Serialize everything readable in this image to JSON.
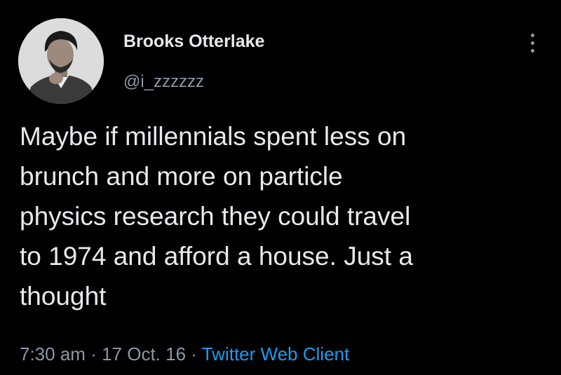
{
  "author": {
    "display_name": "Brooks Otterlake",
    "handle": "@i_zzzzzz",
    "avatar_icon": "profile-photo"
  },
  "menu": {
    "icon": "more-options-icon"
  },
  "tweet": {
    "lines": [
      "Maybe if millennials spent less on",
      "brunch and more on particle",
      "physics research they could travel",
      "to 1974 and afford a house. Just a",
      "thought"
    ]
  },
  "meta": {
    "time": "7:30 am",
    "separator": "·",
    "date": "17 Oct. 16",
    "source": "Twitter Web Client"
  },
  "colors": {
    "background": "#000000",
    "primary_text": "#e7e9ea",
    "secondary_text": "#8b98a5",
    "link": "#1d9bf0"
  }
}
